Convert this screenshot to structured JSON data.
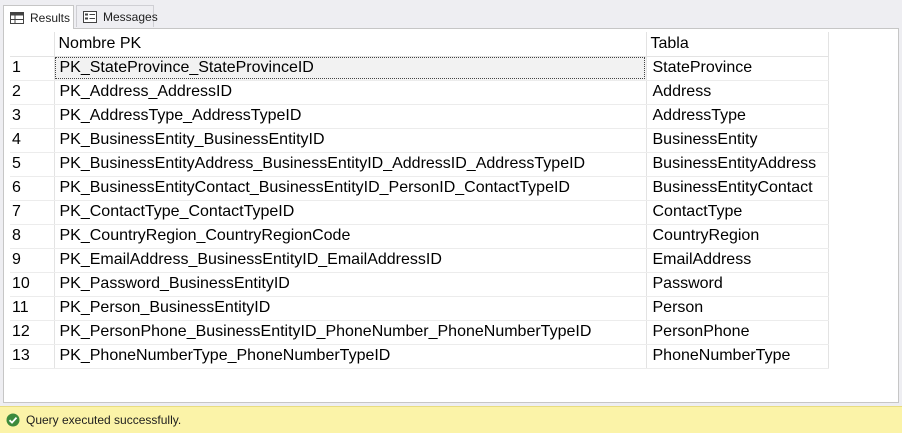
{
  "tabs": {
    "results_label": "Results",
    "messages_label": "Messages"
  },
  "grid": {
    "columns": [
      "Nombre PK",
      "Tabla"
    ],
    "rows": [
      {
        "num": "1",
        "pk": "PK_StateProvince_StateProvinceID",
        "tabla": "StateProvince"
      },
      {
        "num": "2",
        "pk": "PK_Address_AddressID",
        "tabla": "Address"
      },
      {
        "num": "3",
        "pk": "PK_AddressType_AddressTypeID",
        "tabla": "AddressType"
      },
      {
        "num": "4",
        "pk": "PK_BusinessEntity_BusinessEntityID",
        "tabla": "BusinessEntity"
      },
      {
        "num": "5",
        "pk": "PK_BusinessEntityAddress_BusinessEntityID_AddressID_AddressTypeID",
        "tabla": "BusinessEntityAddress"
      },
      {
        "num": "6",
        "pk": "PK_BusinessEntityContact_BusinessEntityID_PersonID_ContactTypeID",
        "tabla": "BusinessEntityContact"
      },
      {
        "num": "7",
        "pk": "PK_ContactType_ContactTypeID",
        "tabla": "ContactType"
      },
      {
        "num": "8",
        "pk": "PK_CountryRegion_CountryRegionCode",
        "tabla": "CountryRegion"
      },
      {
        "num": "9",
        "pk": "PK_EmailAddress_BusinessEntityID_EmailAddressID",
        "tabla": "EmailAddress"
      },
      {
        "num": "10",
        "pk": "PK_Password_BusinessEntityID",
        "tabla": "Password"
      },
      {
        "num": "11",
        "pk": "PK_Person_BusinessEntityID",
        "tabla": "Person"
      },
      {
        "num": "12",
        "pk": "PK_PersonPhone_BusinessEntityID_PhoneNumber_PhoneNumberTypeID",
        "tabla": "PersonPhone"
      },
      {
        "num": "13",
        "pk": "PK_PhoneNumberType_PhoneNumberTypeID",
        "tabla": "PhoneNumberType"
      }
    ]
  },
  "status": {
    "message": "Query executed successfully.",
    "color": "#fbf3a8"
  },
  "icons": {
    "results": "grid-icon",
    "messages": "messages-icon",
    "status": "check-circle-icon"
  }
}
